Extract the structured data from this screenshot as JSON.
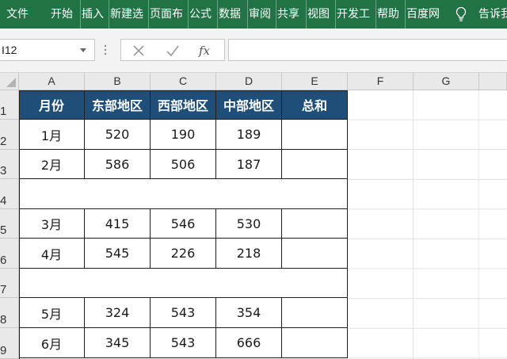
{
  "ribbon": {
    "tabs": [
      "文件",
      "开始",
      "插入",
      "新建选",
      "页面布",
      "公式",
      "数据",
      "审阅",
      "共享",
      "视图",
      "开发工",
      "帮助",
      "百度网"
    ],
    "tell_me": "告诉我"
  },
  "formula_bar": {
    "name_box": "I12",
    "fx_label": "fx",
    "formula": ""
  },
  "columns": [
    "A",
    "B",
    "C",
    "D",
    "E",
    "F",
    "G"
  ],
  "rows": [
    "1",
    "2",
    "3",
    "4",
    "5",
    "6",
    "7",
    "8",
    "9"
  ],
  "table": {
    "headers": [
      "月份",
      "东部地区",
      "西部地区",
      "中部地区",
      "总和"
    ],
    "rows": [
      [
        "1月",
        "520",
        "190",
        "189",
        ""
      ],
      [
        "2月",
        "586",
        "506",
        "187",
        ""
      ],
      null,
      [
        "3月",
        "415",
        "546",
        "530",
        ""
      ],
      [
        "4月",
        "545",
        "226",
        "218",
        ""
      ],
      null,
      [
        "5月",
        "324",
        "543",
        "354",
        ""
      ],
      [
        "6月",
        "345",
        "543",
        "666",
        ""
      ]
    ]
  },
  "colors": {
    "ribbon": "#217346",
    "header_fill": "#1f4e79",
    "header_text": "#ffffff"
  }
}
